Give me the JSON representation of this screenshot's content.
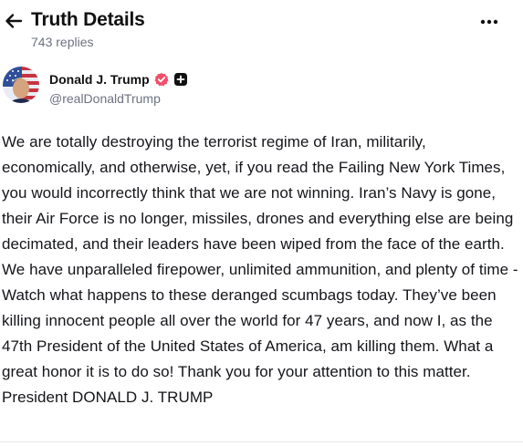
{
  "header": {
    "title": "Truth Details",
    "reply_count": "743 replies",
    "back_icon": "arrow-left-icon",
    "more_icon": "ellipsis-horizontal-icon"
  },
  "author": {
    "name": "Donald J. Trump",
    "handle": "@realDonaldTrump",
    "verified_icon": "verified-badge-icon",
    "verified_color": "#ef4f6a",
    "plus_icon": "plus-square-icon"
  },
  "post": {
    "text": "We are totally destroying the terrorist regime of Iran, militarily, economically, and otherwise, yet, if you read the Failing New York Times, you would incorrectly think that we are not winning. Iran’s Navy is gone, their Air Force is no longer, missiles, drones and everything else are being decimated, and their leaders have been wiped from the face of the earth. We have unparalleled firepower, unlimited ammunition, and plenty of time - Watch what happens to these deranged scumbags today. They’ve been killing innocent people all over the world for 47 years, and now I, as the 47th President of the United States of America, am killing them. What a great honor it is to do so! Thank you for your attention to this matter. President DONALD J. TRUMP"
  },
  "colors": {
    "text_primary": "#14151a",
    "text_secondary": "#6b7280",
    "divider": "#e5e7eb"
  }
}
